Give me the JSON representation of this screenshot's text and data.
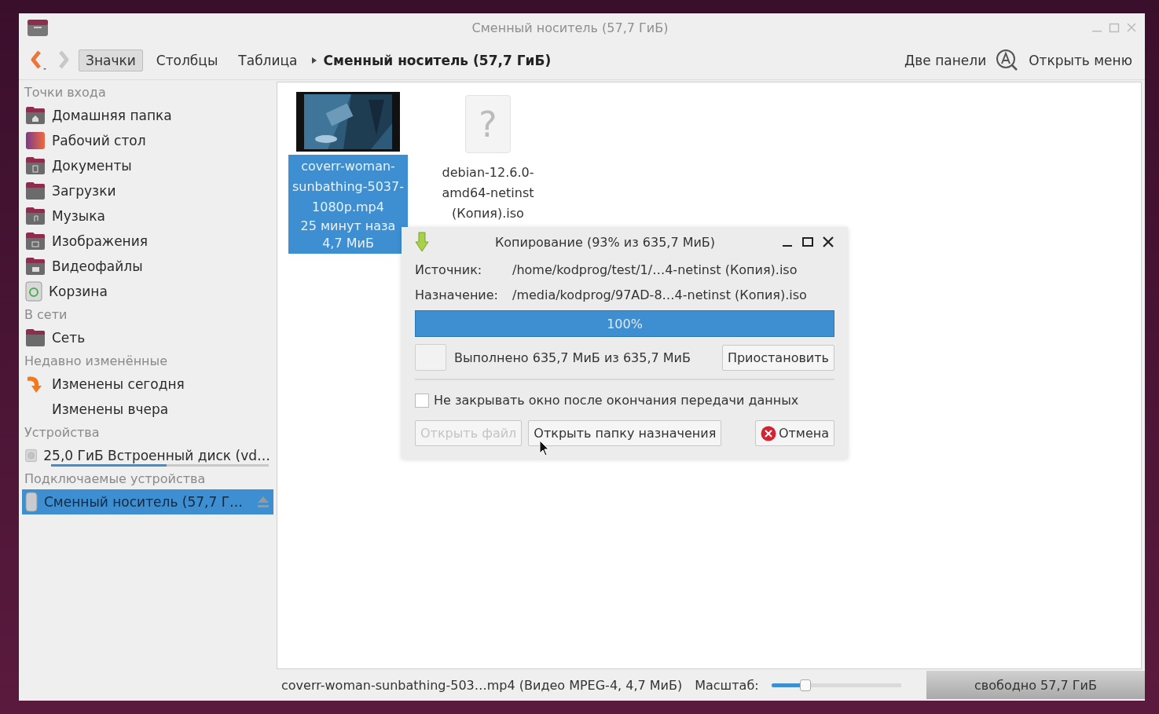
{
  "window": {
    "title": "Сменный носитель (57,7 ГиБ)"
  },
  "toolbar": {
    "views": [
      {
        "label": "Значки",
        "selected": true
      },
      {
        "label": "Столбцы",
        "selected": false
      },
      {
        "label": "Таблица",
        "selected": false
      }
    ],
    "location": "Сменный носитель (57,7 ГиБ)",
    "dual_pane": "Две панели",
    "menu": "Открыть меню"
  },
  "sidebar": {
    "sections": [
      {
        "title": "Точки входа",
        "items": [
          {
            "label": "Домашняя папка",
            "kind": "home",
            "selected": false
          },
          {
            "label": "Рабочий стол",
            "kind": "desktop",
            "selected": false
          },
          {
            "label": "Документы",
            "kind": "documents",
            "selected": false
          },
          {
            "label": "Загрузки",
            "kind": "folder",
            "selected": false
          },
          {
            "label": "Музыка",
            "kind": "music",
            "selected": false
          },
          {
            "label": "Изображения",
            "kind": "pictures",
            "selected": false
          },
          {
            "label": "Видеофайлы",
            "kind": "videos",
            "selected": false
          },
          {
            "label": "Корзина",
            "kind": "trash",
            "selected": false
          }
        ]
      },
      {
        "title": "В сети",
        "items": [
          {
            "label": "Сеть",
            "kind": "folder",
            "selected": false
          }
        ]
      },
      {
        "title": "Недавно изменённые",
        "items": [
          {
            "label": "Изменены сегодня",
            "kind": "recent",
            "selected": false
          },
          {
            "label": "Изменены вчера",
            "kind": "none",
            "selected": false
          }
        ]
      },
      {
        "title": "Устройства",
        "items": [
          {
            "label": "25,0 ГиБ Встроенный диск (vd…",
            "kind": "disk",
            "level": 0.53,
            "selected": false
          }
        ]
      },
      {
        "title": "Подключаемые устройства",
        "items": [
          {
            "label": "Сменный носитель (57,7 Г…",
            "kind": "usb",
            "eject": true,
            "selected": true
          }
        ]
      }
    ]
  },
  "files": [
    {
      "kind": "video",
      "name_lines": [
        "coverr-woman-",
        "sunbathing-5037-",
        "1080p.mp4"
      ],
      "details": [
        "25 минут наза",
        "4,7 МиБ"
      ],
      "selected": true
    },
    {
      "kind": "unknown",
      "glyph": "?",
      "name_lines": [
        "debian-12.6.0-",
        "amd64-netinst",
        "(Копия).iso"
      ],
      "selected": false
    }
  ],
  "dialog": {
    "title": "Копирование (93% из 635,7 МиБ)",
    "fields": [
      {
        "label": "Источник:",
        "value": "/home/kodprog/test/1/…4-netinst (Копия).iso"
      },
      {
        "label": "Назначение:",
        "value": "/media/kodprog/97AD-8…4-netinst (Копия).iso"
      }
    ],
    "progress": {
      "level": 1,
      "text": "100%"
    },
    "done": "Выполнено 635,7 МиБ из 635,7 МиБ",
    "pause": "Приостановить",
    "keep_open": {
      "label": "Не закрывать окно после окончания передачи данных",
      "checked": false
    },
    "buttons": [
      {
        "label": "Открыть файл",
        "kind": "plain",
        "disabled": true
      },
      {
        "label": "Открыть папку назначения",
        "kind": "plain",
        "disabled": false
      },
      {
        "label": "Отмена",
        "kind": "cancel",
        "disabled": false
      }
    ]
  },
  "status_bar": {
    "file": "coverr-woman-sunbathing-503…mp4 (Видео MPEG-4, 4,7 МиБ)",
    "zoom_label": "Масштаб:",
    "zoom": {
      "level": 0.27
    },
    "free": "свободно 57,7 ГиБ"
  }
}
